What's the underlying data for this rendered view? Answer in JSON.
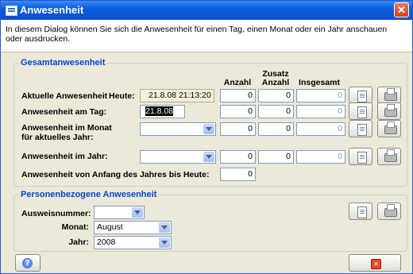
{
  "window": {
    "title": "Anwesenheit"
  },
  "description": "In diesem Dialog können Sie sich die Anwesenheit für einen Tag, einen Monat oder ein Jahr anschauen oder ausdrucken.",
  "group1": {
    "legend": "Gesamtanwesenheit",
    "headers": {
      "anzahl": "Anzahl",
      "zusatz": "Zusatz Anzahl",
      "insgesamt": "Insgesamt"
    },
    "row_current": {
      "label": "Aktuelle Anwesenheit",
      "heute_label": "Heute:",
      "datetime": "21.8.08 21:13:20",
      "anzahl": "0",
      "zusatz": "0",
      "insgesamt": "0"
    },
    "row_day": {
      "label": "Anwesenheit am Tag:",
      "date": "21.8.08",
      "anzahl": "0",
      "zusatz": "0",
      "insgesamt": "0"
    },
    "row_month": {
      "label": "Anwesenheit im Monat für aktuelles Jahr:",
      "selected": "",
      "anzahl": "0",
      "zusatz": "0",
      "insgesamt": "0"
    },
    "row_year": {
      "label": "Anwesenheit im Jahr:",
      "selected": "",
      "anzahl": "0",
      "zusatz": "0",
      "insgesamt": "0"
    },
    "row_ytd": {
      "label": "Anwesenheit von Anfang des Jahres bis Heute:",
      "anzahl": "0"
    }
  },
  "group2": {
    "legend": "Personenbezogene Anwesenheit",
    "ausweis_label": "Ausweisnummer:",
    "ausweis_value": "",
    "monat_label": "Monat:",
    "monat_value": "August",
    "jahr_label": "Jahr:",
    "jahr_value": "2008"
  },
  "icons": {
    "preview": "document-preview-icon",
    "print": "printer-icon",
    "help": "help-icon",
    "close": "close-icon"
  },
  "colors": {
    "titlebar": "#0a5ddc",
    "legend": "#0046d5",
    "dialog_bg": "#ece9d8",
    "readonly_bg": "#f4efd9"
  }
}
